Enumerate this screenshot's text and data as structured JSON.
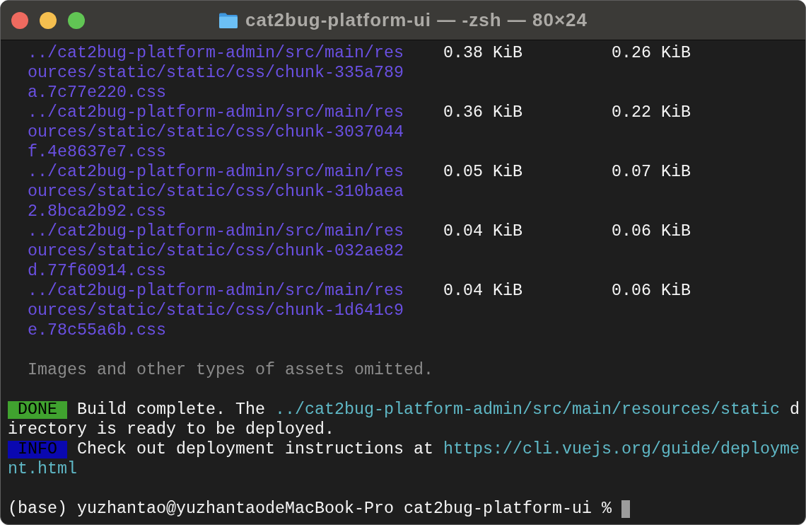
{
  "window": {
    "title": "cat2bug-platform-ui — -zsh — 80×24"
  },
  "assets": [
    {
      "column_1": "../cat2bug-platform-admin/src/main/resources/static/static/css/chunk-335a789a.7c77e220.css",
      "column_2": "0.38 KiB",
      "column_3": "0.26 KiB"
    },
    {
      "column_1": "../cat2bug-platform-admin/src/main/resources/static/static/css/chunk-3037044f.4e8637e7.css",
      "column_2": "0.36 KiB",
      "column_3": "0.22 KiB"
    },
    {
      "column_1": "../cat2bug-platform-admin/src/main/resources/static/static/css/chunk-310baea2.8bca2b92.css",
      "column_2": "0.05 KiB",
      "column_3": "0.07 KiB"
    },
    {
      "column_1": "../cat2bug-platform-admin/src/main/resources/static/static/css/chunk-032ae82d.77f60914.css",
      "column_2": "0.04 KiB",
      "column_3": "0.06 KiB"
    },
    {
      "column_1": "../cat2bug-platform-admin/src/main/resources/static/static/css/chunk-1d641c9e.78c55a6b.css",
      "column_2": "0.04 KiB",
      "column_3": "0.06 KiB"
    }
  ],
  "note": "Images and other types of assets omitted.",
  "messages": [
    {
      "kind": "done",
      "badge": "DONE",
      "rows": [
        [
          {
            "kind": "text",
            "text": "Build complete. The"
          },
          {
            "kind": "link",
            "text": "../cat2bug-platform-admin/src/main/resources/static"
          },
          {
            "kind": "text",
            "text": "d"
          }
        ],
        [
          {
            "kind": "text",
            "text": "irectory is ready to be deployed."
          }
        ]
      ]
    },
    {
      "kind": "info",
      "badge": "INFO",
      "rows": [
        [
          {
            "kind": "text",
            "text": "Check out deployment instructions at"
          },
          {
            "kind": "link",
            "text": "https://cli.vuejs.org/guide/deployme"
          }
        ],
        [
          {
            "kind": "link",
            "text": "nt.html"
          }
        ]
      ]
    }
  ],
  "prompt": {
    "text": "(base) yuzhantao@yuzhantaodeMacBook-Pro cat2bug-platform-ui %"
  }
}
